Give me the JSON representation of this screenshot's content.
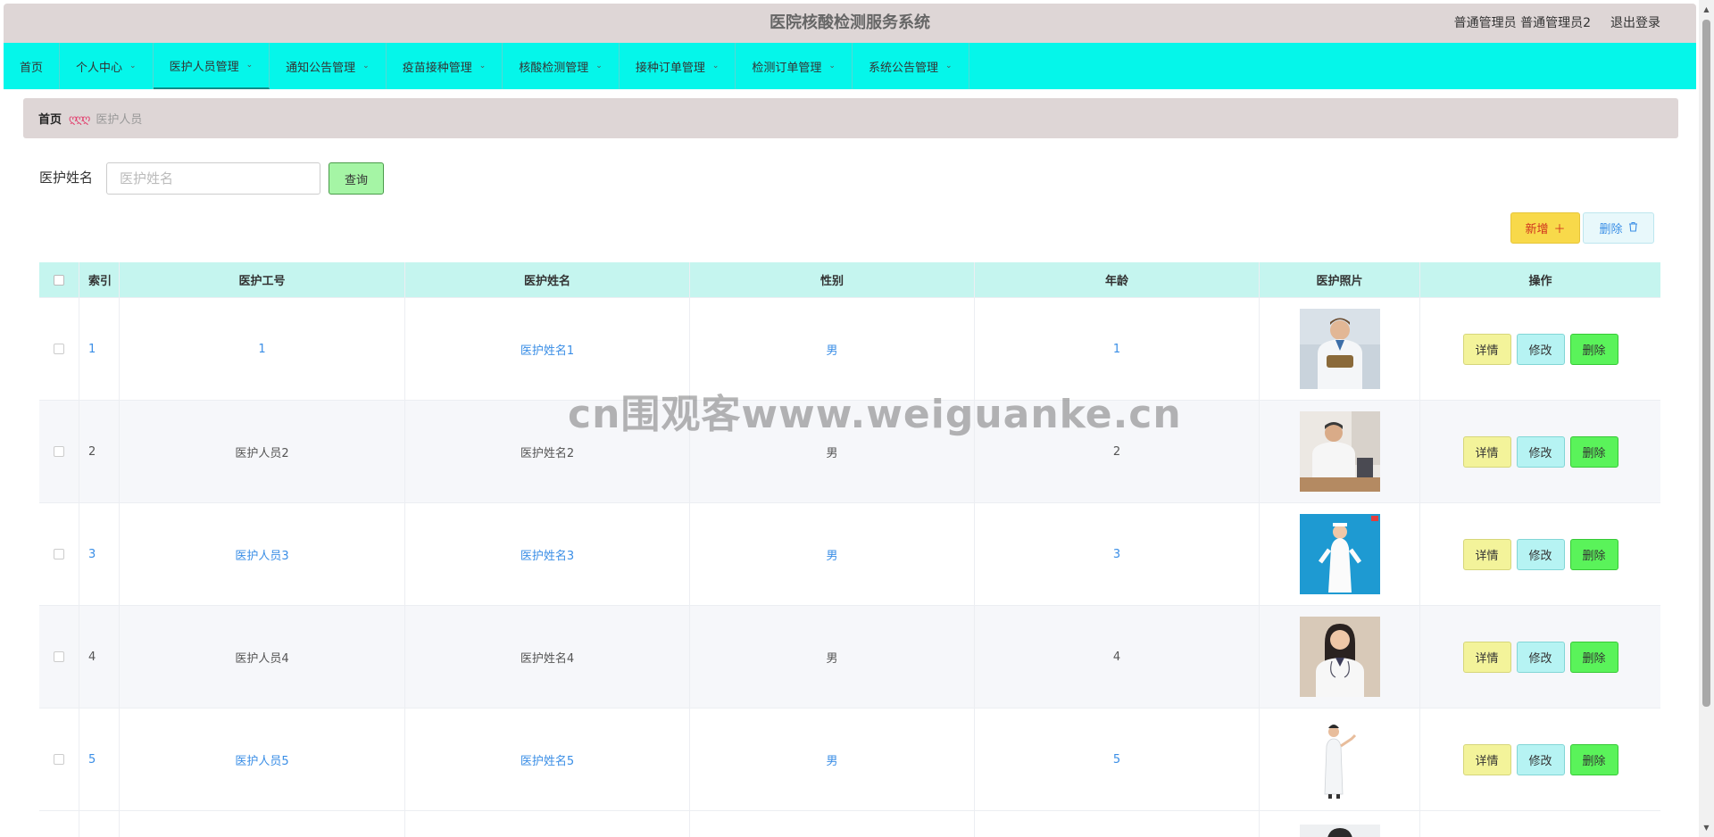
{
  "header": {
    "title": "医院核酸检测服务系统",
    "user": "普通管理员 普通管理员2",
    "logout": "退出登录"
  },
  "nav": [
    {
      "label": "首页",
      "dropdown": false
    },
    {
      "label": "个人中心",
      "dropdown": true
    },
    {
      "label": "医护人员管理",
      "dropdown": true,
      "active": true
    },
    {
      "label": "通知公告管理",
      "dropdown": true
    },
    {
      "label": "疫苗接种管理",
      "dropdown": true
    },
    {
      "label": "核酸检测管理",
      "dropdown": true
    },
    {
      "label": "接种订单管理",
      "dropdown": true
    },
    {
      "label": "检测订单管理",
      "dropdown": true
    },
    {
      "label": "系统公告管理",
      "dropdown": true
    }
  ],
  "breadcrumb": {
    "home": "首页",
    "separator": "ღღღ",
    "current": "医护人员"
  },
  "search": {
    "label": "医护姓名",
    "placeholder": "医护姓名",
    "value": "",
    "button": "查询"
  },
  "actions": {
    "add_label": "新增",
    "add_icon": "＋",
    "delete_label": "删除",
    "delete_icon": "🗑"
  },
  "table": {
    "columns": [
      "索引",
      "医护工号",
      "医护姓名",
      "性别",
      "年龄",
      "医护照片",
      "操作"
    ],
    "rows": [
      {
        "index": "1",
        "no": "1",
        "name": "医护姓名1",
        "sex": "男",
        "age": "1",
        "photo": "doctor-photo",
        "link": true
      },
      {
        "index": "2",
        "no": "医护人员2",
        "name": "医护姓名2",
        "sex": "男",
        "age": "2",
        "photo": "doctor-photo",
        "link": false
      },
      {
        "index": "3",
        "no": "医护人员3",
        "name": "医护姓名3",
        "sex": "男",
        "age": "3",
        "photo": "nurse-photo",
        "link": true
      },
      {
        "index": "4",
        "no": "医护人员4",
        "name": "医护姓名4",
        "sex": "男",
        "age": "4",
        "photo": "doctor-photo",
        "link": false
      },
      {
        "index": "5",
        "no": "医护人员5",
        "name": "医护姓名5",
        "sex": "男",
        "age": "5",
        "photo": "doctor-photo",
        "link": true
      }
    ],
    "op_labels": {
      "detail": "详情",
      "edit": "修改",
      "delete": "删除"
    }
  },
  "watermark": "cn围观客www.weiguanke.cn",
  "colors": {
    "nav_bg": "#05f6ea",
    "header_bg": "#ded6d6",
    "table_head_bg": "#c5f5ef",
    "link": "#3a8ee6"
  }
}
